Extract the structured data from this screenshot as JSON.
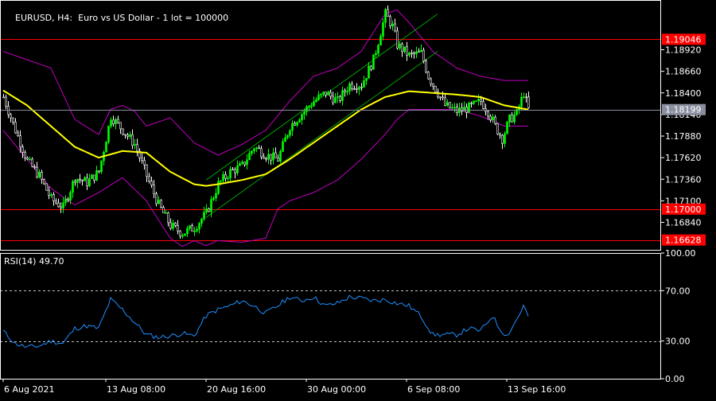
{
  "header": {
    "symbol": "EURUSD",
    "timeframe": "H4:",
    "description": "Euro vs US Dollar - 1 lot = 100000"
  },
  "rsi_header": "RSI(14) 49.70",
  "colors": {
    "background": "#000000",
    "bull_candle": "#00ff00",
    "bear_candle": "#ffffff",
    "moving_average": "#ffff00",
    "bollinger": "#c000c0",
    "channel": "#00a000",
    "hline": "#ff0000",
    "price_line": "#8a8fa0",
    "rsi_line": "#1e90ff",
    "grid": "#ffffff"
  },
  "chart_data": [
    {
      "type": "candlestick",
      "title": "EURUSD, H4:  Euro vs US Dollar - 1 lot = 100000",
      "ylim": [
        1.165,
        1.195
      ],
      "y_ticks": [
        "1.18920",
        "1.18660",
        "1.18400",
        "1.18140",
        "1.17880",
        "1.17620",
        "1.17360",
        "1.17100",
        "1.16840"
      ],
      "x_ticks": [
        "6 Aug 2021",
        "13 Aug 08:00",
        "20 Aug 16:00",
        "30 Aug 00:00",
        "6 Sep 08:00",
        "13 Sep 16:00"
      ],
      "x_tick_index": [
        0,
        43,
        85,
        127,
        169,
        211
      ],
      "n_bars": 221,
      "level_labels": [
        {
          "value": 1.19046,
          "label": "1.19046"
        },
        {
          "value": 1.17,
          "label": "1.17000"
        },
        {
          "value": 1.16628,
          "label": "1.16628"
        }
      ],
      "current_price": {
        "value": 1.18199,
        "label": "1.18199"
      },
      "close_anchors": [
        [
          0,
          1.1835
        ],
        [
          5,
          1.1795
        ],
        [
          10,
          1.1758
        ],
        [
          15,
          1.174
        ],
        [
          20,
          1.1712
        ],
        [
          25,
          1.1702
        ],
        [
          30,
          1.1738
        ],
        [
          35,
          1.1732
        ],
        [
          40,
          1.1745
        ],
        [
          45,
          1.1812
        ],
        [
          50,
          1.1795
        ],
        [
          55,
          1.1778
        ],
        [
          60,
          1.174
        ],
        [
          65,
          1.1705
        ],
        [
          70,
          1.168
        ],
        [
          75,
          1.1671
        ],
        [
          80,
          1.1678
        ],
        [
          85,
          1.1695
        ],
        [
          90,
          1.173
        ],
        [
          95,
          1.1745
        ],
        [
          100,
          1.1752
        ],
        [
          105,
          1.1775
        ],
        [
          110,
          1.1765
        ],
        [
          115,
          1.176
        ],
        [
          120,
          1.18
        ],
        [
          125,
          1.1815
        ],
        [
          130,
          1.183
        ],
        [
          135,
          1.184
        ],
        [
          140,
          1.183
        ],
        [
          145,
          1.185
        ],
        [
          150,
          1.185
        ],
        [
          155,
          1.188
        ],
        [
          160,
          1.1935
        ],
        [
          163,
          1.192
        ],
        [
          165,
          1.1898
        ],
        [
          170,
          1.1885
        ],
        [
          175,
          1.1888
        ],
        [
          178,
          1.186
        ],
        [
          182,
          1.184
        ],
        [
          185,
          1.1825
        ],
        [
          190,
          1.1818
        ],
        [
          195,
          1.1822
        ],
        [
          200,
          1.183
        ],
        [
          203,
          1.1818
        ],
        [
          206,
          1.18
        ],
        [
          209,
          1.1785
        ],
        [
          212,
          1.1808
        ],
        [
          215,
          1.1815
        ],
        [
          218,
          1.184
        ],
        [
          220,
          1.182
        ]
      ],
      "moving_average_anchors": [
        [
          0,
          1.1843
        ],
        [
          10,
          1.1825
        ],
        [
          20,
          1.18
        ],
        [
          30,
          1.1775
        ],
        [
          40,
          1.1762
        ],
        [
          50,
          1.177
        ],
        [
          60,
          1.1768
        ],
        [
          70,
          1.1745
        ],
        [
          80,
          1.173
        ],
        [
          85,
          1.1728
        ],
        [
          90,
          1.173
        ],
        [
          100,
          1.1735
        ],
        [
          110,
          1.1742
        ],
        [
          120,
          1.176
        ],
        [
          130,
          1.178
        ],
        [
          140,
          1.18
        ],
        [
          150,
          1.182
        ],
        [
          160,
          1.1835
        ],
        [
          170,
          1.1842
        ],
        [
          180,
          1.184
        ],
        [
          190,
          1.1838
        ],
        [
          200,
          1.1835
        ],
        [
          210,
          1.1825
        ],
        [
          220,
          1.182
        ]
      ],
      "bollinger_upper_anchors": [
        [
          0,
          1.189
        ],
        [
          10,
          1.188
        ],
        [
          20,
          1.187
        ],
        [
          30,
          1.1808
        ],
        [
          40,
          1.179
        ],
        [
          45,
          1.182
        ],
        [
          50,
          1.1825
        ],
        [
          55,
          1.1818
        ],
        [
          60,
          1.18
        ],
        [
          70,
          1.181
        ],
        [
          80,
          1.178
        ],
        [
          90,
          1.1765
        ],
        [
          100,
          1.1778
        ],
        [
          110,
          1.1795
        ],
        [
          120,
          1.183
        ],
        [
          130,
          1.186
        ],
        [
          140,
          1.187
        ],
        [
          150,
          1.189
        ],
        [
          160,
          1.1935
        ],
        [
          165,
          1.194
        ],
        [
          170,
          1.1925
        ],
        [
          180,
          1.189
        ],
        [
          190,
          1.187
        ],
        [
          200,
          1.186
        ],
        [
          210,
          1.1855
        ],
        [
          220,
          1.1855
        ]
      ],
      "bollinger_lower_anchors": [
        [
          0,
          1.1795
        ],
        [
          10,
          1.176
        ],
        [
          20,
          1.1725
        ],
        [
          30,
          1.1705
        ],
        [
          40,
          1.172
        ],
        [
          50,
          1.1738
        ],
        [
          60,
          1.171
        ],
        [
          70,
          1.1665
        ],
        [
          75,
          1.1655
        ],
        [
          80,
          1.1662
        ],
        [
          85,
          1.1656
        ],
        [
          90,
          1.1662
        ],
        [
          100,
          1.166
        ],
        [
          110,
          1.1665
        ],
        [
          115,
          1.17
        ],
        [
          120,
          1.171
        ],
        [
          130,
          1.172
        ],
        [
          140,
          1.1735
        ],
        [
          150,
          1.176
        ],
        [
          160,
          1.179
        ],
        [
          165,
          1.1808
        ],
        [
          170,
          1.182
        ],
        [
          180,
          1.182
        ],
        [
          190,
          1.182
        ],
        [
          200,
          1.1812
        ],
        [
          210,
          1.18
        ],
        [
          220,
          1.18
        ]
      ],
      "channel_lines": [
        {
          "from": [
            85,
            1.169
          ],
          "to": [
            182,
            1.189
          ]
        },
        {
          "from": [
            85,
            1.1735
          ],
          "to": [
            182,
            1.1935
          ]
        }
      ]
    },
    {
      "type": "line",
      "title": "RSI(14) 49.70",
      "ylim": [
        0,
        100
      ],
      "y_ticks": [
        "100.00",
        "70.00",
        "30.00",
        "0.00"
      ],
      "dashed_levels": [
        70,
        30
      ],
      "rsi_anchors": [
        [
          0,
          38
        ],
        [
          5,
          28
        ],
        [
          10,
          25
        ],
        [
          15,
          26
        ],
        [
          20,
          30
        ],
        [
          25,
          28
        ],
        [
          30,
          40
        ],
        [
          35,
          42
        ],
        [
          40,
          40
        ],
        [
          45,
          63
        ],
        [
          50,
          55
        ],
        [
          55,
          45
        ],
        [
          60,
          35
        ],
        [
          65,
          33
        ],
        [
          70,
          34
        ],
        [
          75,
          36
        ],
        [
          80,
          34
        ],
        [
          85,
          50
        ],
        [
          90,
          55
        ],
        [
          95,
          58
        ],
        [
          100,
          62
        ],
        [
          105,
          58
        ],
        [
          110,
          52
        ],
        [
          115,
          58
        ],
        [
          120,
          65
        ],
        [
          125,
          62
        ],
        [
          130,
          65
        ],
        [
          135,
          58
        ],
        [
          140,
          60
        ],
        [
          145,
          65
        ],
        [
          150,
          64
        ],
        [
          155,
          62
        ],
        [
          160,
          63
        ],
        [
          165,
          60
        ],
        [
          170,
          58
        ],
        [
          175,
          50
        ],
        [
          180,
          35
        ],
        [
          185,
          35
        ],
        [
          190,
          35
        ],
        [
          195,
          40
        ],
        [
          200,
          38
        ],
        [
          205,
          50
        ],
        [
          208,
          40
        ],
        [
          211,
          34
        ],
        [
          213,
          40
        ],
        [
          216,
          50
        ],
        [
          218,
          58
        ],
        [
          220,
          49.7
        ]
      ]
    }
  ]
}
